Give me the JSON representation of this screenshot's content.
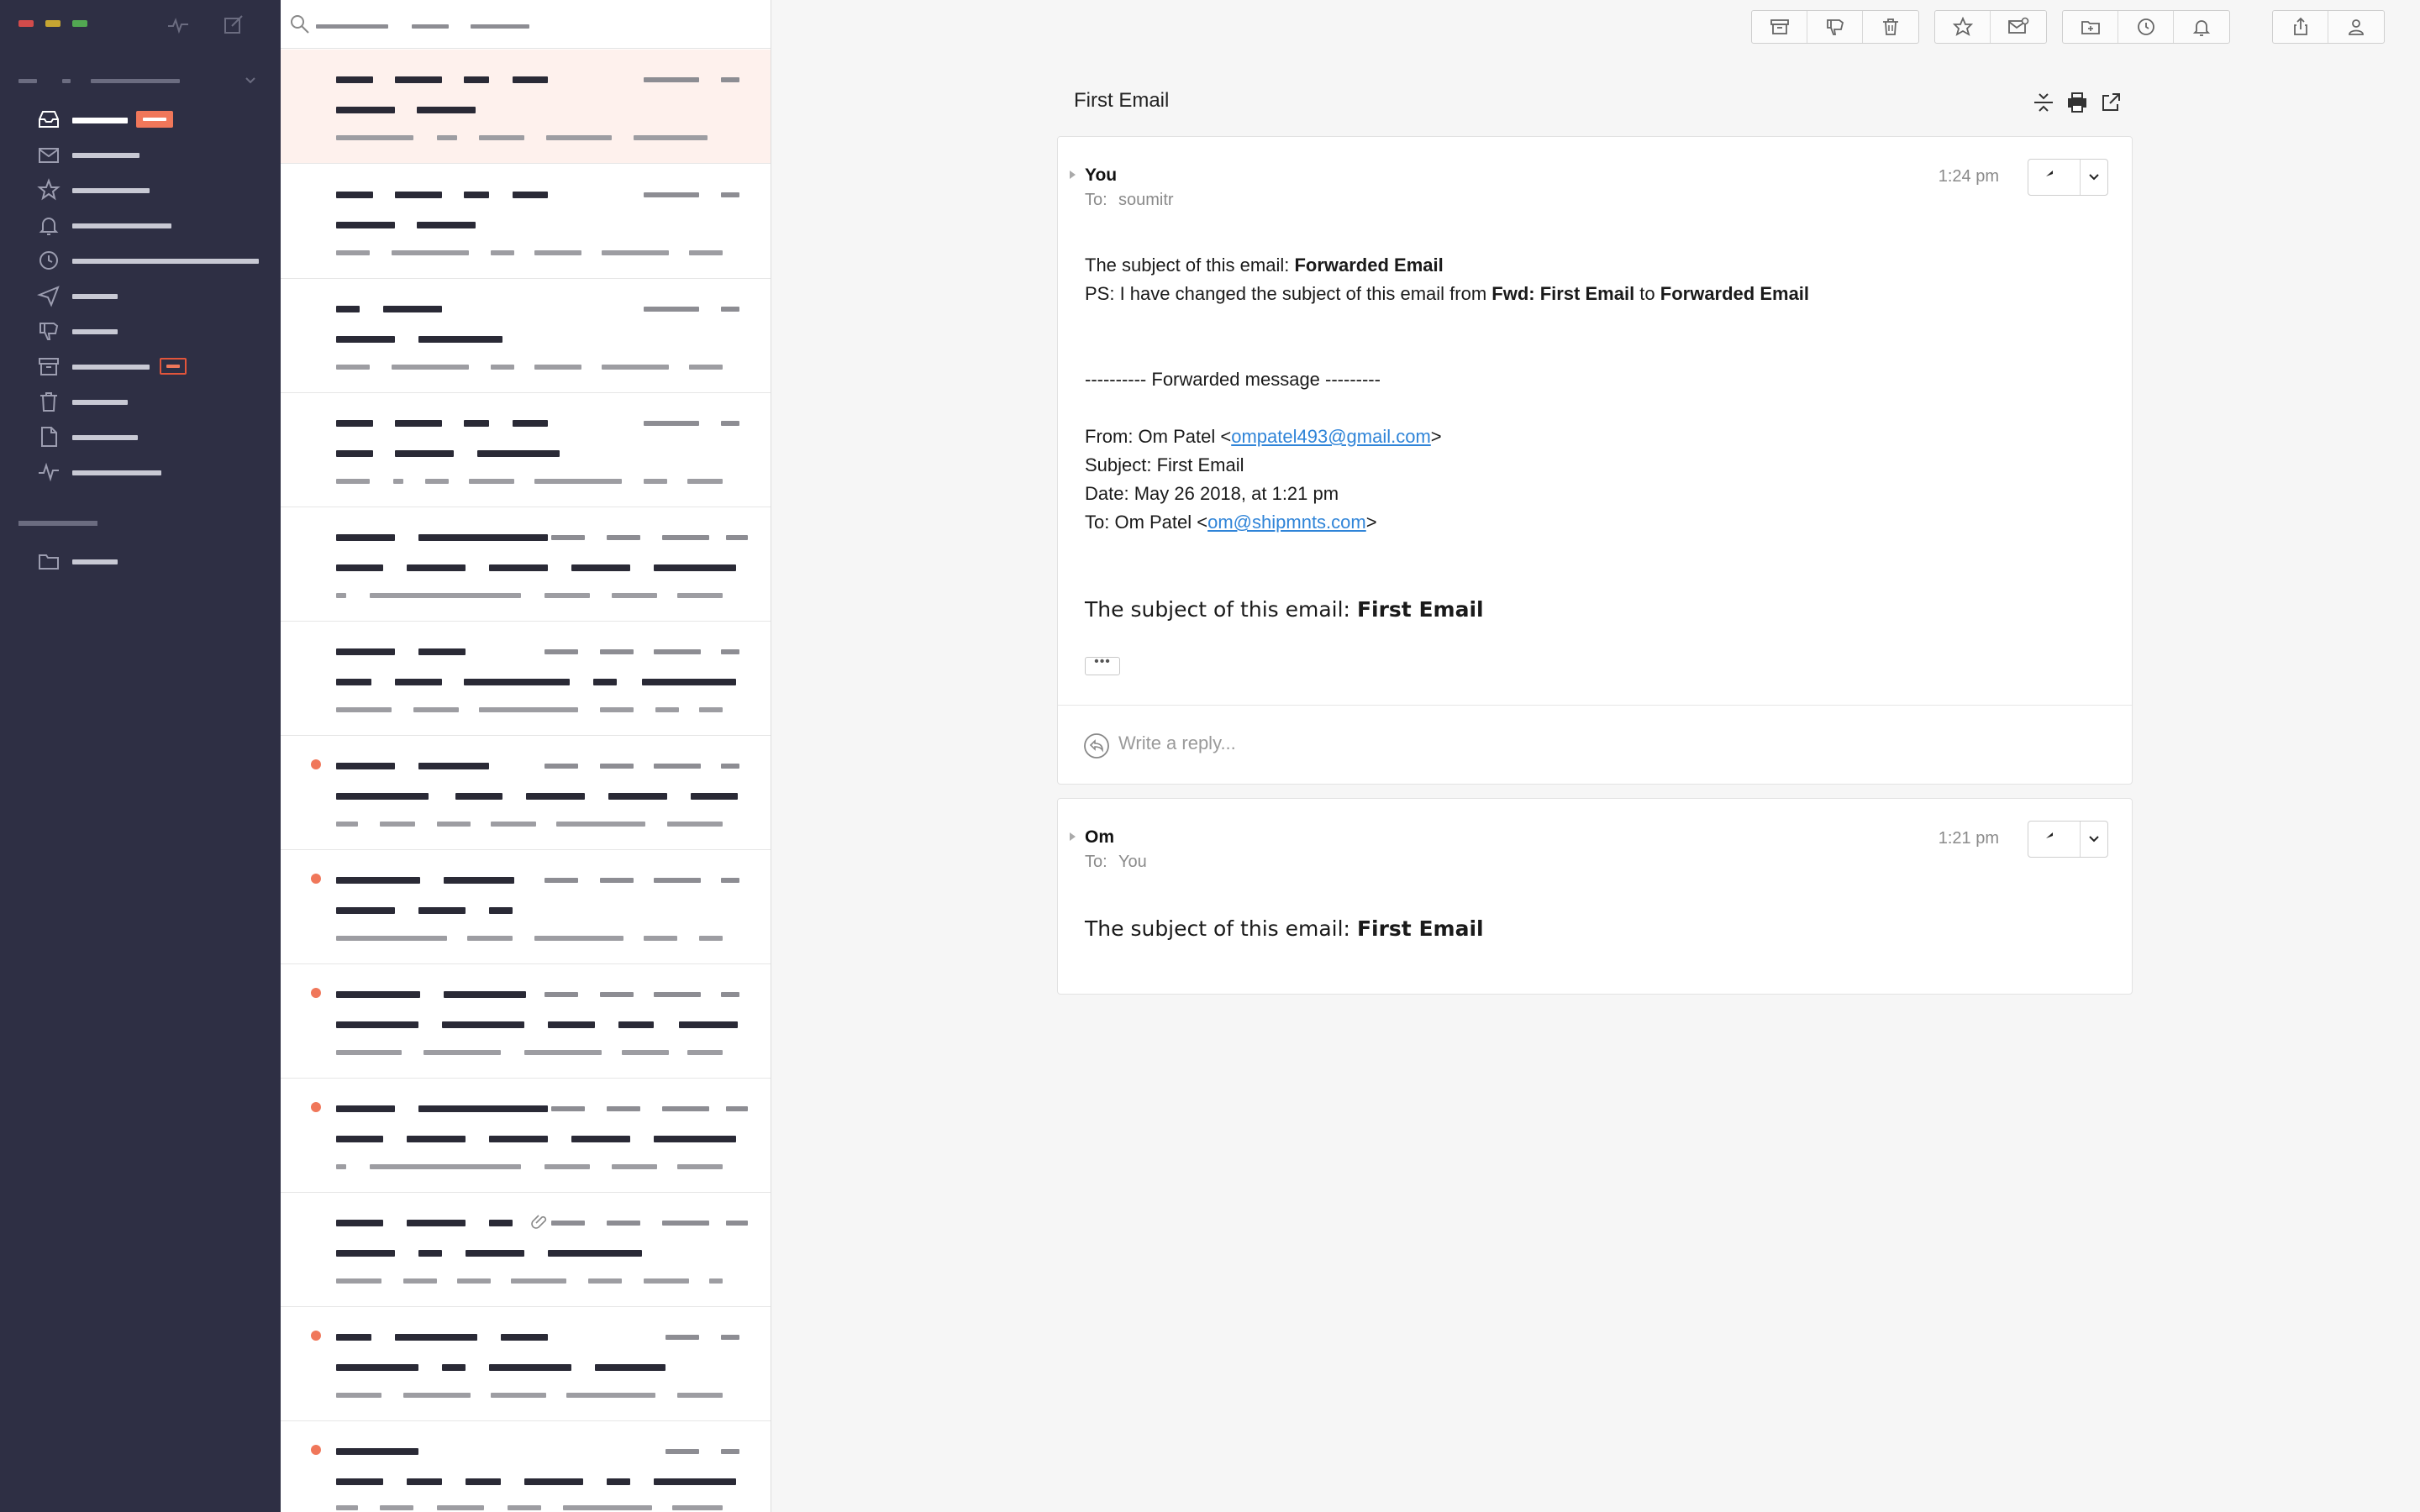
{
  "colors": {
    "sidebar_bg": "#2e2f44",
    "accent": "#f0775a",
    "link": "#2f84d8",
    "selected_row": "#fef1ed"
  },
  "sidebar": {
    "icons": [
      "activity-icon",
      "compose-icon"
    ],
    "nav_icons": [
      "inbox-icon",
      "mail-unread-icon",
      "star-icon",
      "bell-icon",
      "clock-icon",
      "send-icon",
      "thumbs-down-icon",
      "archive-icon",
      "trash-icon",
      "document-icon",
      "activity-icon"
    ],
    "folder_icons": [
      "folder-icon"
    ]
  },
  "toolbar": {
    "icons": [
      "archive-icon",
      "thumbs-down-icon",
      "trash-icon",
      "star-icon",
      "mail-unread-icon",
      "move-to-folder-icon",
      "clock-icon",
      "bell-icon",
      "share-icon",
      "user-icon"
    ]
  },
  "thread": {
    "title": "First Email",
    "tools": [
      "collapse-icon",
      "print-icon",
      "external-link-icon"
    ],
    "reply_placeholder": "Write a reply...",
    "messages": [
      {
        "sender": "You",
        "to_label": "To:",
        "to": "soumitr",
        "time": "1:24 pm",
        "body": {
          "line1_prefix": "The subject of this email: ",
          "line1_bold": "Forwarded Email",
          "ps_prefix": "PS: I have changed the subject of this email from ",
          "ps_bold1": "Fwd: First Email",
          "ps_mid": " to ",
          "ps_bold2": "Forwarded Email",
          "fwd_header": "---------- Forwarded message ---------",
          "from_prefix": "From: Om Patel <",
          "from_email": "ompatel493@gmail.com",
          "from_suffix": ">",
          "subject": "Subject: First Email",
          "date": "Date: May 26 2018, at 1:21 pm",
          "to_prefix": "To: Om Patel <",
          "to_email": "om@shipmnts.com",
          "to_suffix": ">",
          "quoted_prefix": "The subject of this email: ",
          "quoted_bold": "First Email",
          "more": "•••"
        }
      },
      {
        "sender": "Om",
        "to_label": "To:",
        "to": "You",
        "time": "1:21 pm",
        "body": {
          "line_prefix": "The subject of this email: ",
          "line_bold": "First Email"
        }
      }
    ]
  }
}
